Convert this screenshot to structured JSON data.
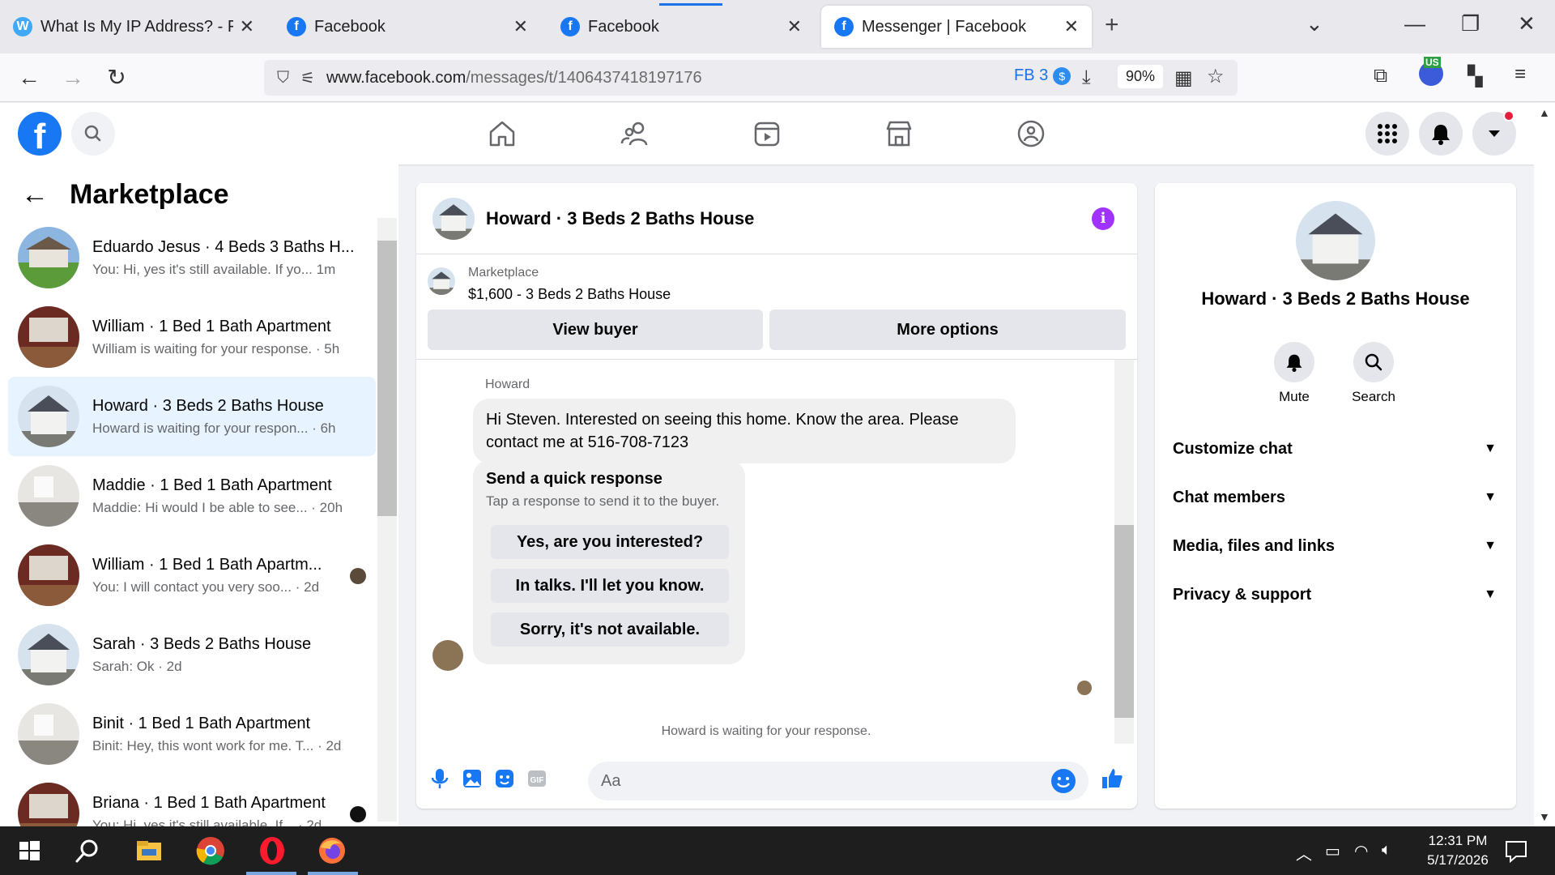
{
  "browser": {
    "tabs": [
      {
        "title": "What Is My IP Address? - Find IP",
        "favicon": "whatismyip-icon",
        "active": false
      },
      {
        "title": "Facebook",
        "favicon": "facebook-icon",
        "active": false
      },
      {
        "title": "Facebook",
        "favicon": "facebook-icon",
        "active": false
      },
      {
        "title": "Messenger | Facebook",
        "favicon": "facebook-icon",
        "active": true
      }
    ],
    "url_domain": "www.facebook.com",
    "url_path": "/messages/t/1406437418197176",
    "ext_badge": "FB 3",
    "ext_coin": "$",
    "zoom": "90%",
    "profile_badge": "US"
  },
  "left_panel": {
    "title": "Marketplace",
    "conversations": [
      {
        "name": "Eduardo Jesus · 4 Beds 3 Baths H...",
        "preview": "You: Hi, yes it's still available. If yo...",
        "time": "1m",
        "selected": false,
        "thumb": "green-house"
      },
      {
        "name": "William · 1 Bed 1 Bath Apartment",
        "preview": "William is waiting for your response.",
        "time": "5h",
        "selected": false,
        "thumb": "red-kitchen"
      },
      {
        "name": "Howard · 3 Beds 2 Baths House",
        "preview": "Howard is waiting for your respon...",
        "time": "6h",
        "selected": true,
        "thumb": "grey-house"
      },
      {
        "name": "Maddie · 1 Bed 1 Bath Apartment",
        "preview": "Maddie: Hi would I be able to see...",
        "time": "20h",
        "selected": false,
        "thumb": "white-room"
      },
      {
        "name": "William · 1 Bed 1 Bath Apartm...",
        "preview": "You: I will contact you very soo...",
        "time": "2d",
        "selected": false,
        "thumb": "red-kitchen"
      },
      {
        "name": "Sarah · 3 Beds 2 Baths House",
        "preview": "Sarah: Ok",
        "time": "2d",
        "selected": false,
        "thumb": "grey-house"
      },
      {
        "name": "Binit · 1 Bed 1 Bath Apartment",
        "preview": "Binit: Hey, this wont work for me. T...",
        "time": "2d",
        "selected": false,
        "thumb": "white-room"
      },
      {
        "name": "Briana · 1 Bed 1 Bath Apartment",
        "preview": "You: Hi, yes it's still available. If...",
        "time": "2d",
        "selected": false,
        "thumb": "red-kitchen"
      }
    ]
  },
  "chat": {
    "title": "Howard · 3 Beds 2 Baths House",
    "listing_label": "Marketplace",
    "listing_price": "$1,600 - 3 Beds 2 Baths House",
    "view_buyer": "View buyer",
    "more_options": "More options",
    "sender": "Howard",
    "message": "Hi Steven. Interested on seeing this home. Know the area. Please contact me at 516-708-7123",
    "quick_title": "Send a quick response",
    "quick_subtitle": "Tap a response to send it to the buyer.",
    "quick_responses": [
      "Yes, are you interested?",
      "In talks. I'll let you know.",
      "Sorry, it's not available."
    ],
    "waiting": "Howard is waiting for your response.",
    "input_placeholder": "Aa"
  },
  "right_panel": {
    "name": "Howard · 3 Beds 2 Baths House",
    "mute": "Mute",
    "search": "Search",
    "sections": [
      "Customize chat",
      "Chat members",
      "Media, files and links",
      "Privacy & support"
    ]
  },
  "taskbar": {
    "time": "12:31 PM",
    "date": "5/17/2026"
  },
  "colors": {
    "fb_blue": "#1877f2",
    "info_purple": "#a033ff",
    "selected_bg": "#e7f3ff"
  }
}
